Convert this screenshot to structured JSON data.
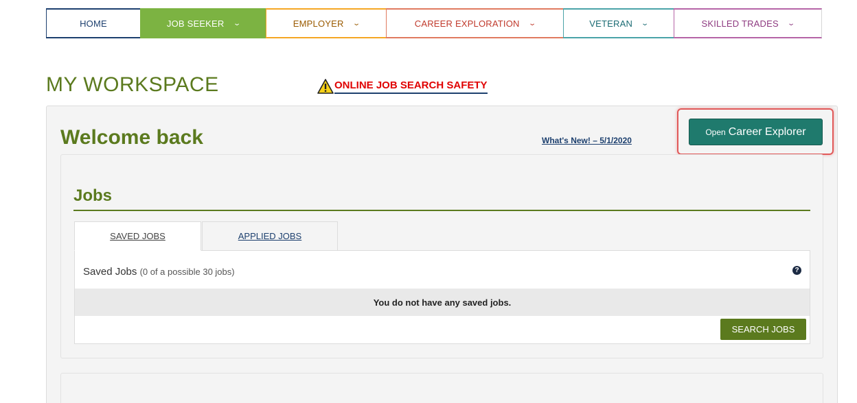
{
  "nav": {
    "home": "HOME",
    "job_seeker": "JOB SEEKER",
    "employer": "EMPLOYER",
    "career_exploration": "CAREER EXPLORATION",
    "veteran": "VETERAN",
    "skilled_trades": "SKILLED TRADES",
    "chevron": "⌄"
  },
  "header": {
    "title": "MY WORKSPACE",
    "safety_link": "ONLINE JOB SEARCH SAFETY"
  },
  "welcome": {
    "title": "Welcome back",
    "whats_new": "What's New! – 5/1/2020",
    "career_explorer_open": "Open",
    "career_explorer_label": "Career Explorer"
  },
  "jobs": {
    "title": "Jobs",
    "tabs": [
      "SAVED JOBS",
      "APPLIED JOBS"
    ],
    "saved_heading": "Saved Jobs",
    "saved_count": "(0 of a possible 30 jobs)",
    "help_glyph": "?",
    "empty_message": "You do not have any saved jobs.",
    "search_button": "SEARCH JOBS"
  },
  "colors": {
    "brand_green": "#5b7a1e",
    "nav_active": "#7cb342",
    "career_button": "#1f7a6d",
    "warning_red": "#e00000",
    "highlight": "#e15959"
  },
  "icons": {
    "warning": "warning-triangle-icon",
    "help": "question-circle-icon",
    "chevron": "chevron-down-icon"
  }
}
